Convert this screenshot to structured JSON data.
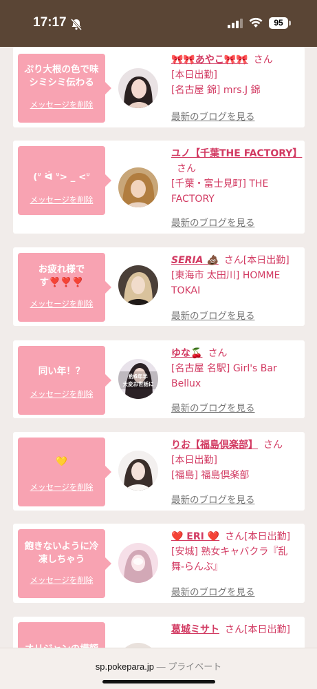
{
  "status": {
    "time": "17:17",
    "battery": "95"
  },
  "urlbar": {
    "domain": "sp.pokepara.jp",
    "mode": "— プライベート"
  },
  "cards": [
    {
      "message": "ぷり大根の色で味\nシミシミ伝わる",
      "delete": "メッセージを削除",
      "name": "🎀🎀あやこ🎀🎀",
      "suffix": "さん",
      "lines": [
        "[本日出勤]",
        "[名古屋 錦] mrs.J 錦"
      ],
      "blog": "最新のブログを見る"
    },
    {
      "message": "(ᐡ ᐛ ᐡ> _ <ᐡ",
      "delete": "メッセージを削除",
      "name": "ユノ【千葉THE FACTORY】",
      "suffix": "さん",
      "lines": [
        "[千葉・富士見町] THE FACTORY"
      ],
      "blog": "最新のブログを見る"
    },
    {
      "message": "お疲れ様で\nす❣️❣️❣️",
      "delete": "メッセージを削除",
      "name": "SERIA 💩",
      "suffix": "さん[本日出勤]",
      "lines": [
        "[東海市 太田川] HOMME TOKAI"
      ],
      "blog": "最新のブログを見る"
    },
    {
      "message": "同い年！？",
      "delete": "メッセージを削除",
      "name": "ゆな🍒",
      "suffix": "さん",
      "lines": [
        "[名古屋 名駅] Girl's Bar Bellux"
      ],
      "blog": "最新のブログを見る"
    },
    {
      "message": "💛",
      "delete": "メッセージを削除",
      "name": "りお【福島倶楽部】",
      "suffix": "さん",
      "lines": [
        "[本日出勤]",
        "[福島] 福島倶楽部"
      ],
      "blog": "最新のブログを見る"
    },
    {
      "message": "飽きないように冷\n凍しちゃう",
      "delete": "メッセージを削除",
      "name": "❤️ ERI ❤️",
      "suffix": "さん[本日出勤]",
      "lines": [
        "[安城] 熟女キャバクラ『乱舞-らんぶ』"
      ],
      "blog": "最新のブログを見る"
    },
    {
      "message": "オリジャンの構額",
      "delete": "",
      "name": "葛城ミサト",
      "suffix": "さん[本日出勤]",
      "lines": [],
      "blog": ""
    }
  ],
  "avatar4_caption": "約6年半\n大変お世話に"
}
